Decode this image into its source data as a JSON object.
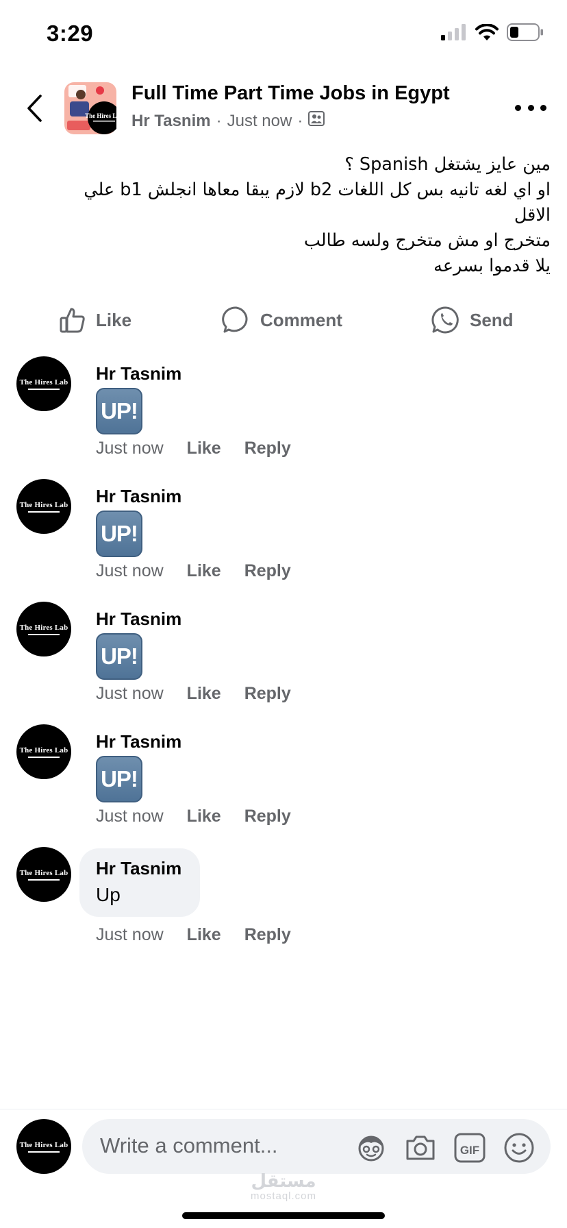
{
  "status": {
    "time": "3:29"
  },
  "header": {
    "group_name": "Full Time Part Time Jobs in Egypt",
    "author": "Hr Tasnim",
    "time": "Just now",
    "sep": "·"
  },
  "post": {
    "lines": [
      "مين عايز يشتغل Spanish ؟",
      "او اي لغه تانيه بس كل اللغات b2 لازم يبقا معاها انجلش b1 علي",
      "الاقل",
      "متخرج او مش متخرج ولسه طالب",
      "يلا قدموا بسرعه"
    ]
  },
  "actions": {
    "like": "Like",
    "comment": "Comment",
    "send": "Send"
  },
  "avatar_text": "The Hires Lab",
  "comments": [
    {
      "name": "Hr Tasnim",
      "emoji": "UP!",
      "time": "Just now",
      "like": "Like",
      "reply": "Reply"
    },
    {
      "name": "Hr Tasnim",
      "emoji": "UP!",
      "time": "Just now",
      "like": "Like",
      "reply": "Reply"
    },
    {
      "name": "Hr Tasnim",
      "emoji": "UP!",
      "time": "Just now",
      "like": "Like",
      "reply": "Reply"
    },
    {
      "name": "Hr Tasnim",
      "emoji": "UP!",
      "time": "Just now",
      "like": "Like",
      "reply": "Reply"
    },
    {
      "name": "Hr Tasnim",
      "text": "Up",
      "time": "Just now",
      "like": "Like",
      "reply": "Reply"
    }
  ],
  "composer": {
    "placeholder": "Write a comment...",
    "gif": "GIF"
  },
  "watermark": {
    "ar": "مستقل",
    "en": "mostaql.com"
  },
  "colors": {
    "text": "#050505",
    "secondary": "#65676b",
    "bubble": "#f0f2f5",
    "emoji_bg": "#5b7fa3"
  }
}
